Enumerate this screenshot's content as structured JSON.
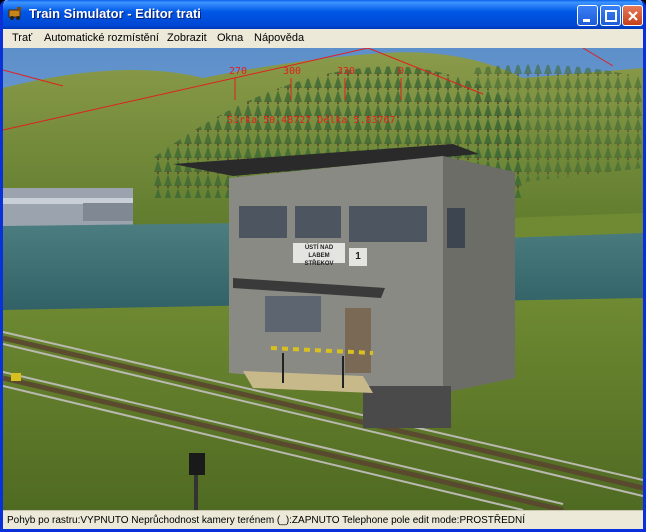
{
  "window": {
    "title": "Train Simulator - Editor trati"
  },
  "menu": [
    "Trať",
    "Automatické rozmístění",
    "Zobrazit",
    "Okna",
    "Nápověda"
  ],
  "compass": {
    "ticks": [
      "270",
      "300",
      "330",
      "0"
    ],
    "readout": "Širka 50.48727 Délka 5.83767"
  },
  "building": {
    "sign_main": "ÚSTÍ NAD LABEM STŘEKOV",
    "sign_number": "1"
  },
  "statusbar": {
    "text": "Pohyb po rastru:VYPNUTO Neprůchodnost kamery terénem (_):ZAPNUTO Telephone pole edit mode:PROSTŘEDNÍ"
  },
  "colors": {
    "titlebar": "#0058e6",
    "hud": "#e02020",
    "sky": "#6f9fd0",
    "grass": "#6b8a2a"
  }
}
